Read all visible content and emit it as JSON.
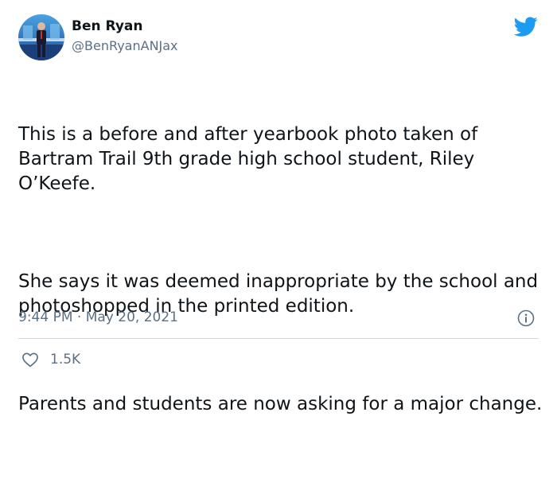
{
  "author": {
    "name": "Ben Ryan",
    "handle": "@BenRyanANJax",
    "avatar_icon": "avatar-photo"
  },
  "tweet": {
    "paragraphs": [
      "This is a before and after yearbook photo taken of Bartram Trail 9th grade high school student, Riley O’Keefe.",
      "She says it was deemed inappropriate by the school and photoshopped in the printed edition.",
      "Parents and students are now asking for a major change."
    ],
    "time": "9:44 PM",
    "separator": " · ",
    "date": "May 20, 2021"
  },
  "actions": {
    "like_icon": "heart-icon",
    "like_count": "1.5K",
    "info_icon": "info-icon"
  },
  "colors": {
    "twitter_blue": "#1d9bf0",
    "muted_text": "#5b7083",
    "divider": "#cfd9de"
  }
}
